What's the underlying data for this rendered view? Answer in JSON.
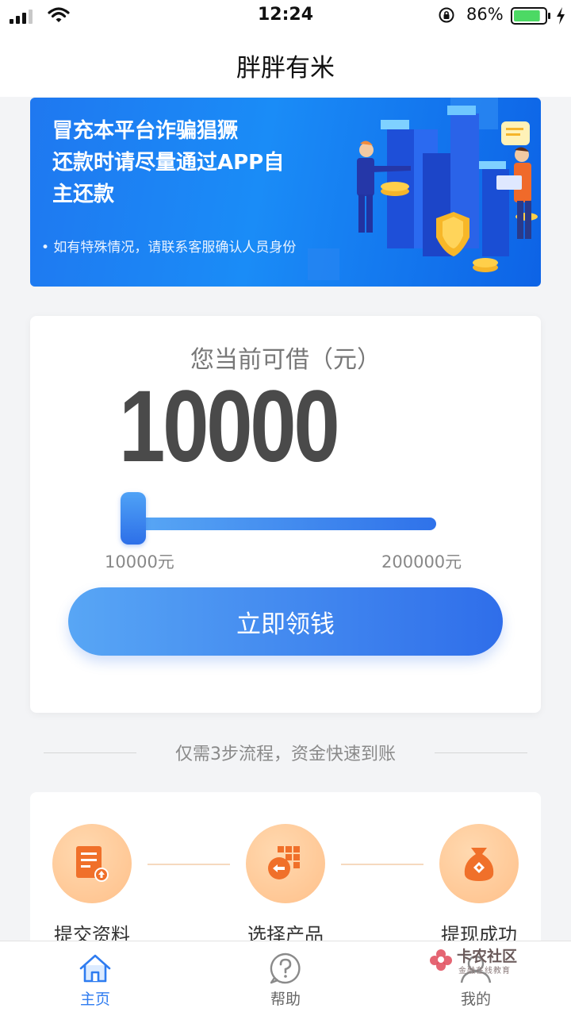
{
  "status_bar": {
    "time": "12:24",
    "battery_percent": "86%",
    "battery_level": 0.86
  },
  "header": {
    "title": "胖胖有米"
  },
  "banner": {
    "lines": [
      "冒充本平台诈骗猖獗",
      "还款时请尽量通过APP自",
      "主还款"
    ],
    "note": "• 如有特殊情况，请联系客服确认人员身份"
  },
  "loan": {
    "caption": "您当前可借（元）",
    "amount": "10000",
    "slider_value": 10000,
    "min_label": "10000元",
    "max_label": "200000元",
    "button_label": "立即领钱"
  },
  "process": {
    "divider_text": "仅需3步流程，资金快速到账",
    "steps": [
      {
        "label": "提交资料",
        "icon": "document-upload-icon"
      },
      {
        "label": "选择产品",
        "icon": "product-grid-icon"
      },
      {
        "label": "提现成功",
        "icon": "money-bag-icon"
      }
    ]
  },
  "tabs": [
    {
      "label": "主页",
      "icon": "home-icon",
      "active": true
    },
    {
      "label": "帮助",
      "icon": "help-icon",
      "active": false
    },
    {
      "label": "我的",
      "icon": "profile-icon",
      "active": false
    }
  ],
  "watermark": {
    "name": "卡农社区",
    "sub": "金融在线教育"
  },
  "colors": {
    "accent": "#2f7cf0",
    "banner_blue": "#1a8cf7",
    "step_orange": "#ffc08a",
    "amount_gray": "#4a4a4a"
  }
}
